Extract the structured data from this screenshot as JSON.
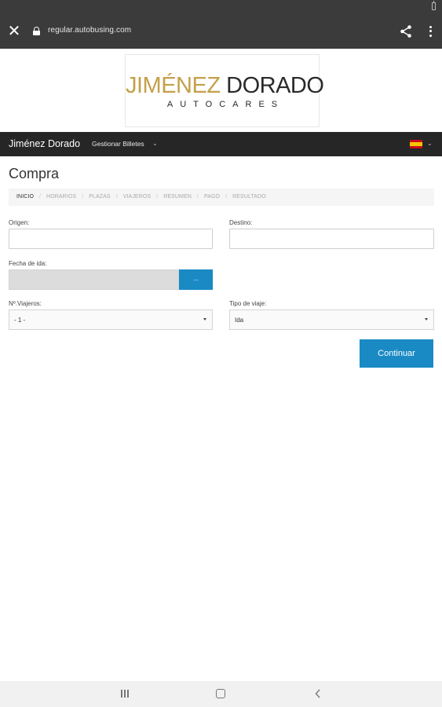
{
  "browser": {
    "url": "regular.autobusing.com"
  },
  "logo": {
    "word1": "JIMÉNEZ",
    "word2": "DORADO",
    "subtitle": "AUTOCARES",
    "gold_color": "#c4a04a"
  },
  "navbar": {
    "brand": "Jiménez Dorado",
    "menu_label": "Gestionar Billetes",
    "language_flag": "spain-flag-icon"
  },
  "page": {
    "title": "Compra",
    "breadcrumb": [
      {
        "label": "INICIO",
        "active": true
      },
      {
        "label": "HORARIOS",
        "active": false
      },
      {
        "label": "PLAZAS",
        "active": false
      },
      {
        "label": "VIAJEROS",
        "active": false
      },
      {
        "label": "RESUMEN",
        "active": false
      },
      {
        "label": "PAGO",
        "active": false
      },
      {
        "label": "RESULTADO",
        "active": false
      }
    ],
    "breadcrumb_separator": "/"
  },
  "form": {
    "origin_label": "Origen:",
    "origin_value": "",
    "destination_label": "Destino:",
    "destination_value": "",
    "date_label": "Fecha de ida:",
    "date_value": "",
    "date_button": "...",
    "travellers_label": "Nº.Viajeros:",
    "travellers_value": "- 1 -",
    "trip_type_label": "Tipo de viaje:",
    "trip_type_value": "Ida",
    "continue_button": "Continuar",
    "accent_color": "#1a8ac4"
  }
}
